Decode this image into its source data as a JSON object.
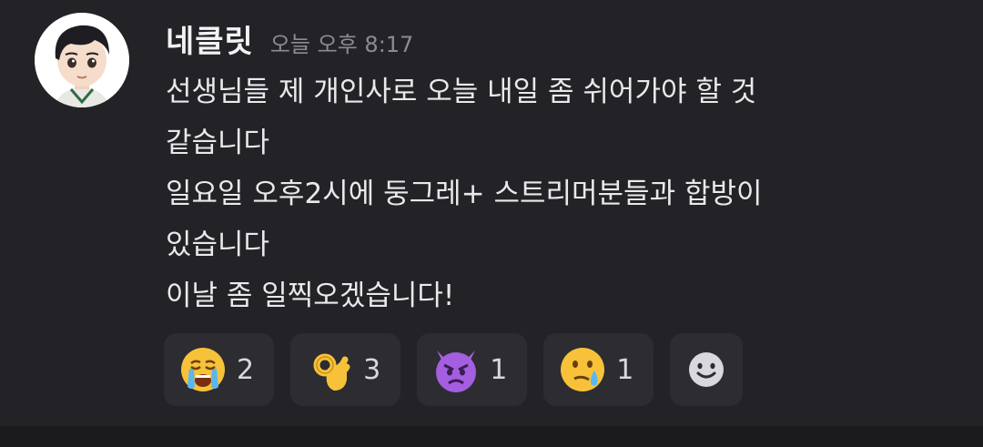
{
  "message": {
    "username": "네클릿",
    "timestamp": "오늘 오후 8:17",
    "lines": [
      "선생님들 제 개인사로 오늘 내일 좀 쉬어가야 할 것",
      "같습니다",
      "일요일 오후2시에 둥그레+ 스트리머분들과 합방이",
      "있습니다",
      "이날 좀 일찍오겠습니다!"
    ]
  },
  "reactions": [
    {
      "icon": "crying-face-icon",
      "count": "2"
    },
    {
      "icon": "ok-hand-icon",
      "count": "3"
    },
    {
      "icon": "angry-devil-icon",
      "count": "1"
    },
    {
      "icon": "face-holding-back-tears-icon",
      "count": "1"
    }
  ],
  "add_reaction_icon": "add-reaction-smiley-icon",
  "colors": {
    "background": "#232327",
    "reaction_bg": "#2c2c31",
    "text": "#e9e9ec",
    "timestamp": "#8b8b93"
  }
}
